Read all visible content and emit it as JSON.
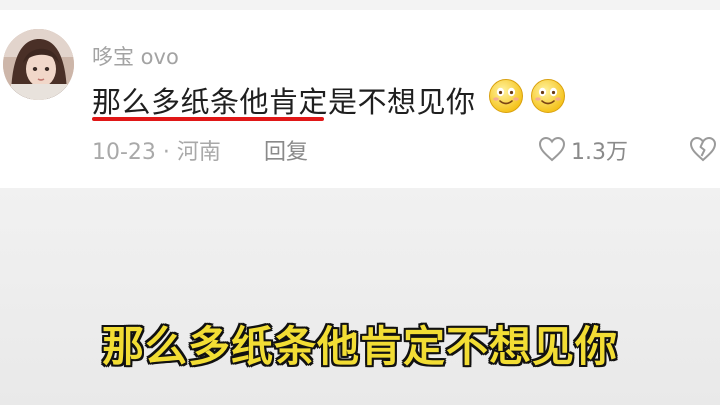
{
  "comment": {
    "username": "哆宝 ovo",
    "text": "那么多纸条他肯定是不想见你",
    "emojis": [
      "smiling-face-icon",
      "smiling-face-icon"
    ],
    "meta": "10-23 · 河南",
    "reply_label": "回复",
    "like_count": "1.3万"
  },
  "subtitle": {
    "text": "那么多纸条他肯定不想见你"
  },
  "colors": {
    "underline": "#e01717",
    "subtitle_fill": "#f2dd34",
    "subtitle_outline": "#111111"
  }
}
